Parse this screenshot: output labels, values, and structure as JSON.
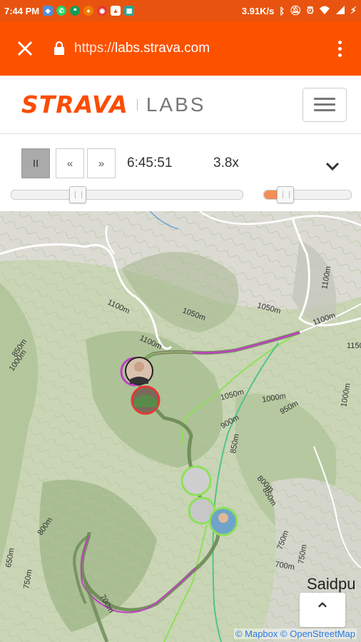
{
  "status": {
    "time": "7:44 PM",
    "net_speed": "3.91K/s",
    "left_icons": [
      "location-icon",
      "whatsapp-icon",
      "hangouts-icon",
      "app-icon",
      "chrome-icon",
      "photos-icon",
      "gallery-icon"
    ],
    "right_icons": [
      "bluetooth-icon",
      "dnd-icon",
      "alarm-icon",
      "wifi-icon",
      "signal-icon",
      "battery-charging-icon"
    ]
  },
  "browser": {
    "url_prefix": "https://",
    "url_host": "labs.strava.com",
    "accent": "#fc5200"
  },
  "header": {
    "logo": "STRAVA",
    "labs": "LABS",
    "brand_color": "#fc4c02"
  },
  "controls": {
    "pause_label": "II",
    "rewind_label": "«",
    "forward_label": "»",
    "time": "6:45:51",
    "speed": "3.8x",
    "time_progress": 0.27,
    "speed_progress": 0.18
  },
  "map": {
    "place_label": "Saidpu",
    "contour_labels": [
      "1100m",
      "1050m",
      "1050m",
      "1100m",
      "1100m",
      "1050m",
      "1000m",
      "950m",
      "900m",
      "850m",
      "800m",
      "750m",
      "700m",
      "700m",
      "750m",
      "800m",
      "650m",
      "750m",
      "850m",
      "1000m",
      "1100m",
      "1000m",
      "1150",
      "850m"
    ],
    "attribution": {
      "mapbox": "© Mapbox",
      "osm": "© OpenStreetMap"
    },
    "scroll_top_label": "⌃"
  }
}
